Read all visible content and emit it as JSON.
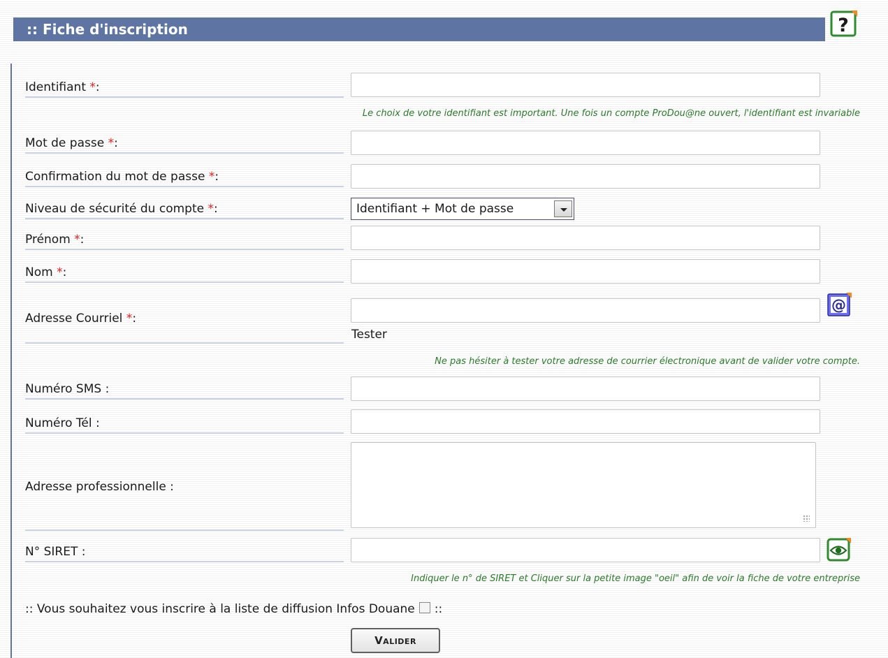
{
  "header": {
    "title": ":: Fiche d'inscription",
    "help_icon": "help-question-icon"
  },
  "form": {
    "identifiant": {
      "label": "Identifiant ",
      "required": "*",
      "suffix": ":",
      "value": ""
    },
    "identifiant_hint": "Le choix de votre identifiant est important. Une fois un compte ProDou@ne ouvert, l'identifiant est invariable",
    "mot_de_passe": {
      "label": "Mot de passe ",
      "required": "*",
      "suffix": ":",
      "value": ""
    },
    "confirmation": {
      "label": "Confirmation du mot de passe ",
      "required": "*",
      "suffix": ":",
      "value": ""
    },
    "securite": {
      "label": "Niveau de sécurité du compte ",
      "required": "*",
      "suffix": ":",
      "selected": "Identifiant + Mot de passe"
    },
    "prenom": {
      "label": "Prénom ",
      "required": "*",
      "suffix": ":",
      "value": ""
    },
    "nom": {
      "label": "Nom ",
      "required": "*",
      "suffix": ":",
      "value": ""
    },
    "courriel": {
      "label": "Adresse Courriel ",
      "required": "*",
      "suffix": ":",
      "value": "",
      "icon": "email-at-icon",
      "test_label": "Tester"
    },
    "courriel_hint": "Ne pas hésiter à tester votre adresse de courrier électronique avant de valider votre compte.",
    "sms": {
      "label": "Numéro SMS :",
      "value": ""
    },
    "tel": {
      "label": "Numéro Tél :",
      "value": ""
    },
    "adresse": {
      "label": "Adresse professionnelle :",
      "value": ""
    },
    "siret": {
      "label": "N° SIRET :",
      "value": "",
      "icon": "eye-icon"
    },
    "siret_hint": "Indiquer le n° de SIRET et Cliquer sur la petite image \"oeil\" afin de voir la fiche de votre entreprise",
    "newsletter": {
      "prefix": ":: Vous souhaitez vous inscrire à la liste de diffusion Infos Douane",
      "suffix": "::",
      "checked": false
    },
    "submit_label": "Valider"
  },
  "colors": {
    "header_bg": "#5e74a3",
    "hint_text": "#2a7a2a",
    "required_star": "#e02020"
  }
}
